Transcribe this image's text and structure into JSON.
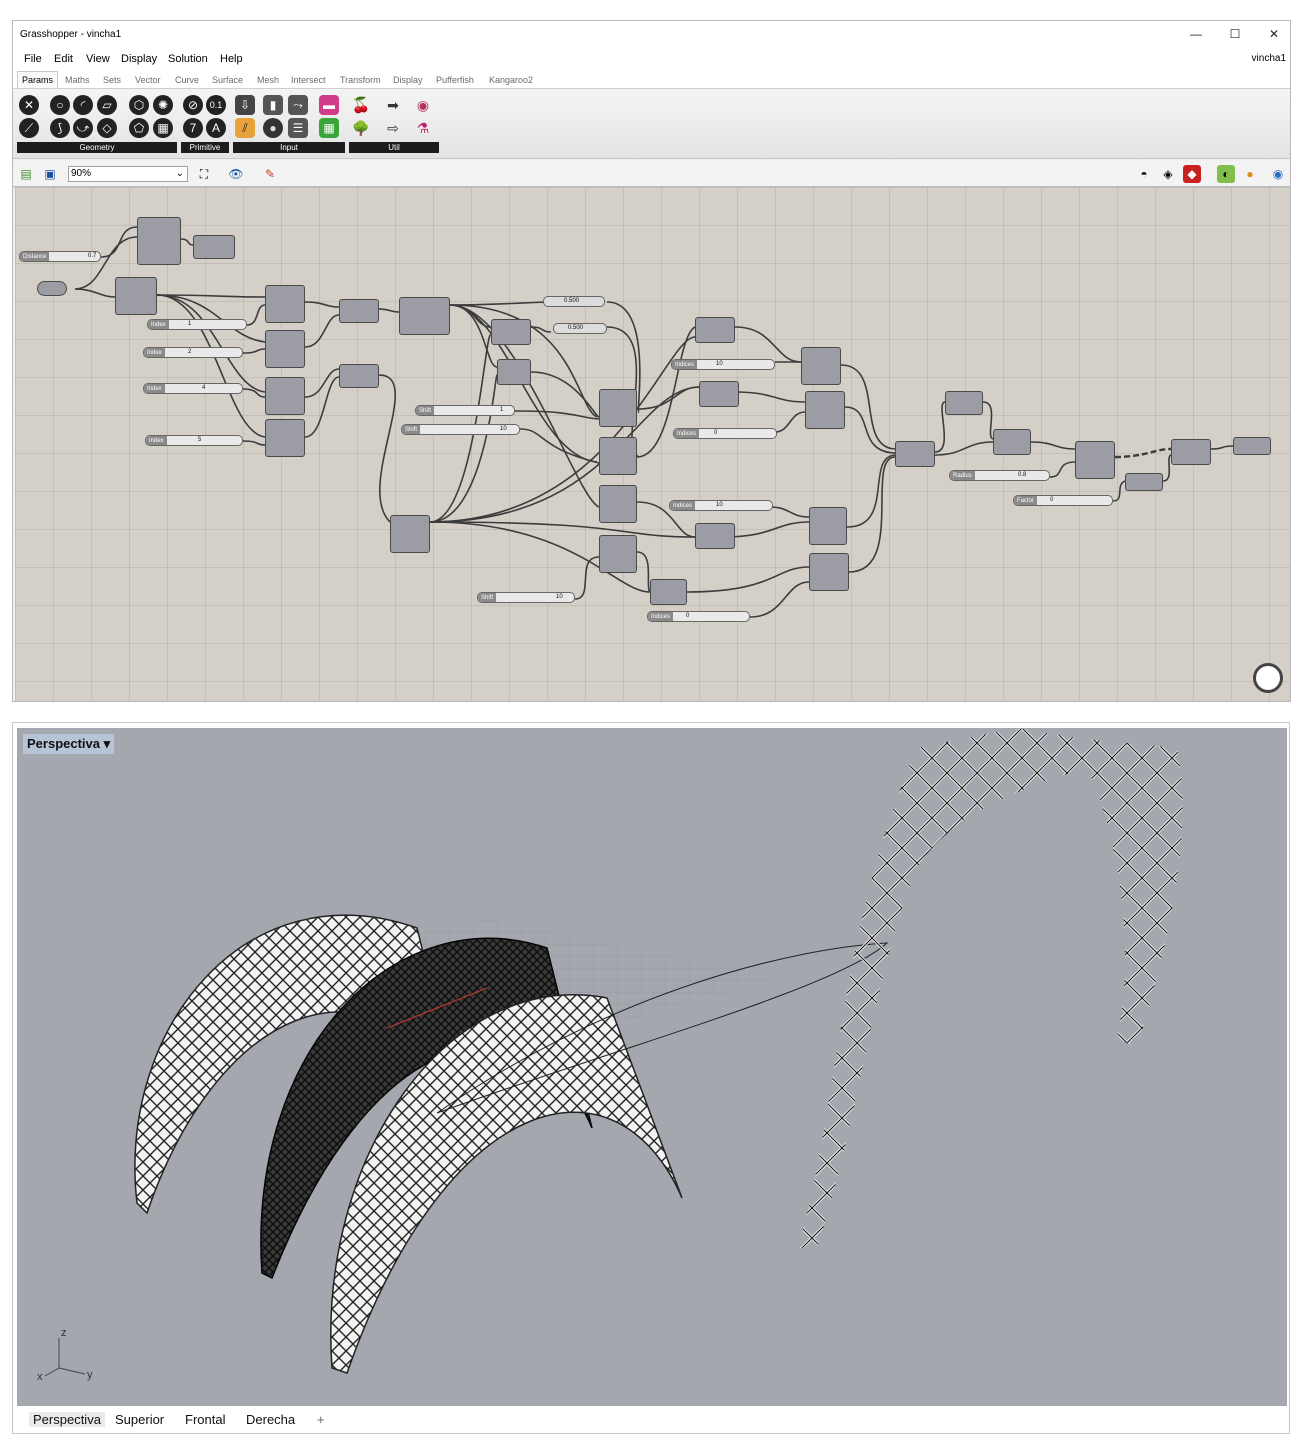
{
  "window": {
    "title": "Grasshopper - vincha1",
    "document": "vincha1"
  },
  "menu": [
    "File",
    "Edit",
    "View",
    "Display",
    "Solution",
    "Help"
  ],
  "tabs": [
    "Params",
    "Maths",
    "Sets",
    "Vector",
    "Curve",
    "Surface",
    "Mesh",
    "Intersect",
    "Transform",
    "Display",
    "Pufferfish",
    "Kangaroo2"
  ],
  "ribbon_groups": [
    "Geometry",
    "Primitive",
    "Input",
    "Util"
  ],
  "zoom": "90%",
  "sliders": {
    "distance": {
      "label": "Distance",
      "value": "0.7"
    },
    "index1": {
      "label": "Index",
      "value": "1"
    },
    "index2": {
      "label": "Index",
      "value": "2"
    },
    "index4": {
      "label": "Index",
      "value": "4"
    },
    "index5": {
      "label": "Index",
      "value": "5"
    },
    "shift1": {
      "label": "Shift",
      "value": "1"
    },
    "shift10a": {
      "label": "Shift",
      "value": "10"
    },
    "shift10b": {
      "label": "Shift",
      "value": "10"
    },
    "indices10a": {
      "label": "Indices",
      "value": "10"
    },
    "indices0a": {
      "label": "Indices",
      "value": "0"
    },
    "indices10b": {
      "label": "Indices",
      "value": "10"
    },
    "indices0b": {
      "label": "Indices",
      "value": "0"
    },
    "radius": {
      "label": "Radius",
      "value": "0.8"
    },
    "factor": {
      "label": "Factor",
      "value": "0"
    },
    "p500a": {
      "label": "",
      "value": "0.500"
    },
    "p500b": {
      "label": "",
      "value": "0.500"
    }
  },
  "viewport": {
    "title": "Perspectiva"
  },
  "view_tabs": [
    "Perspectiva",
    "Superior",
    "Frontal",
    "Derecha"
  ],
  "axes": {
    "x": "x",
    "y": "y",
    "z": "z"
  }
}
